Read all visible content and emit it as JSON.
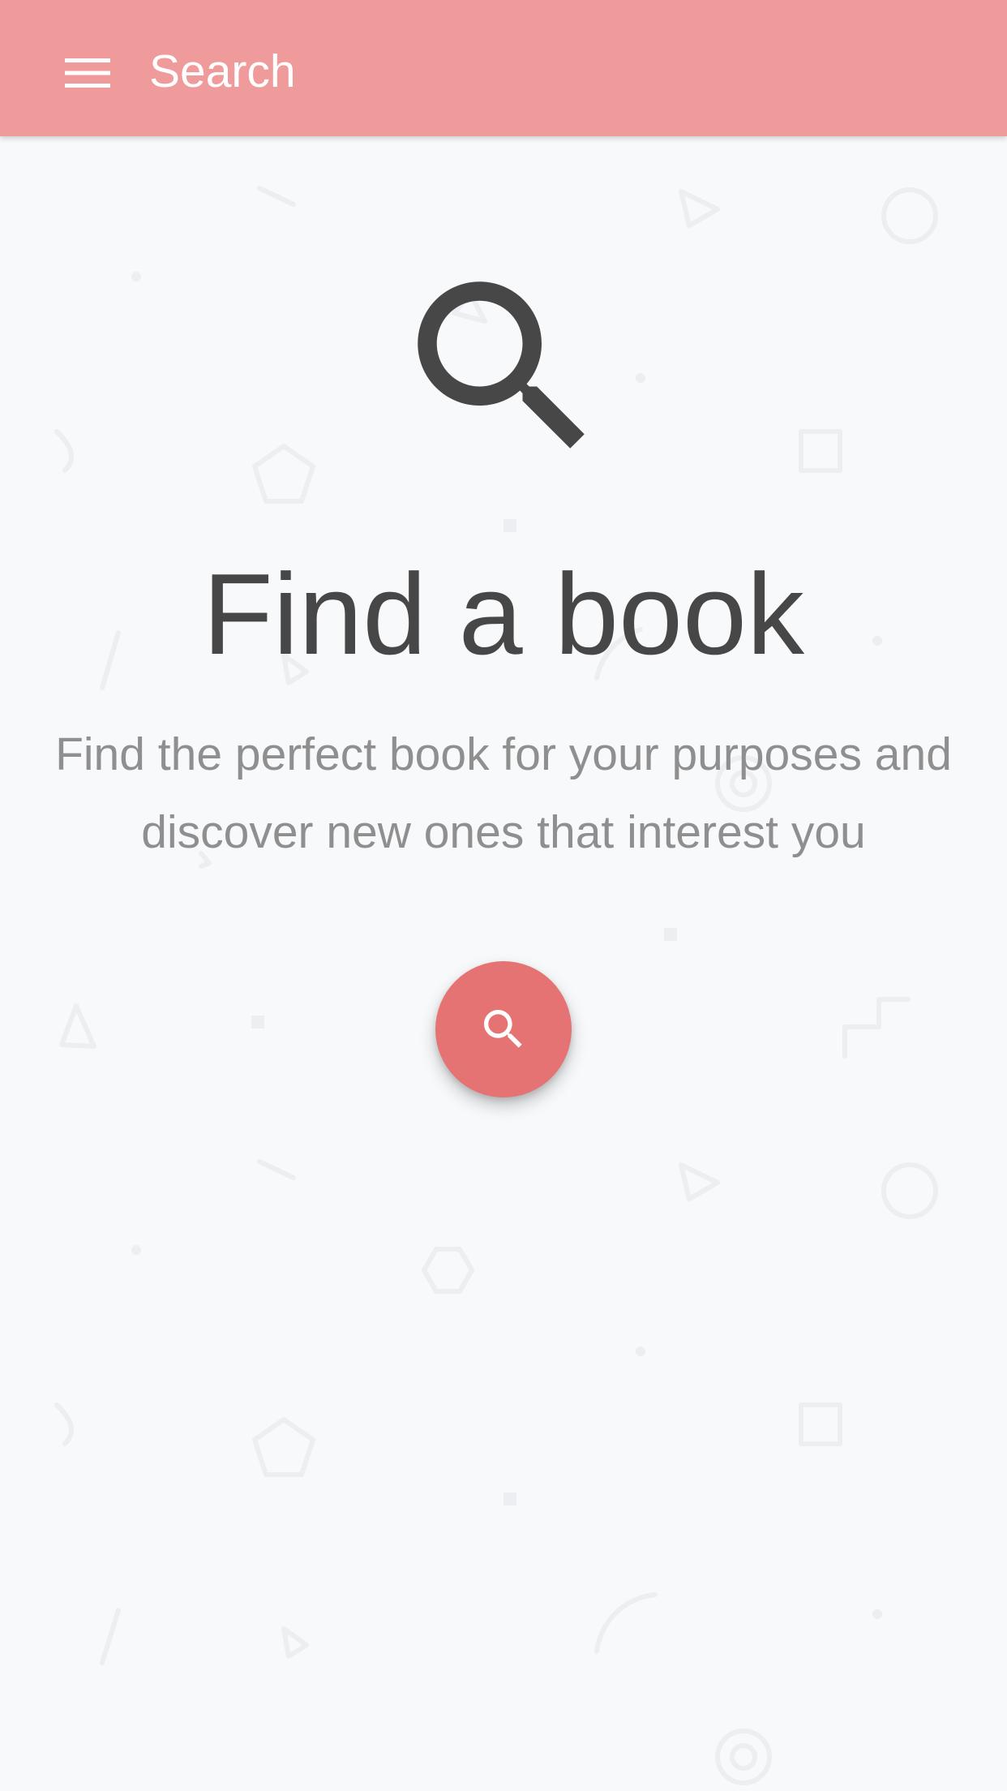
{
  "colors": {
    "appbar_background": "#ef9a9b",
    "accent": "#e57373",
    "headline_text": "#474747",
    "subtitle_text": "#8f8f8f",
    "background": "#f8f9fb",
    "pattern_shapes": "#eceef1"
  },
  "appbar": {
    "menu_icon": "menu-icon",
    "title": "Search"
  },
  "hero": {
    "icon": "search-icon",
    "headline": "Find a book",
    "subtitle": "Find the perfect book for your purposes and discover new ones that interest you"
  },
  "fab": {
    "icon": "search-icon"
  }
}
